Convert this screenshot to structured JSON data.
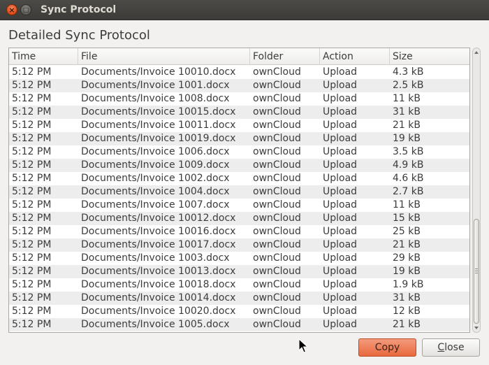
{
  "window": {
    "title": "Sync Protocol"
  },
  "heading": "Detailed Sync Protocol",
  "table": {
    "columns": [
      "Time",
      "File",
      "Folder",
      "Action",
      "Size"
    ],
    "rows": [
      [
        "5:12 PM",
        "Documents/Invoice 10010.docx",
        "ownCloud",
        "Upload",
        "4.3 kB"
      ],
      [
        "5:12 PM",
        "Documents/Invoice 1001.docx",
        "ownCloud",
        "Upload",
        "2.5 kB"
      ],
      [
        "5:12 PM",
        "Documents/Invoice 1008.docx",
        "ownCloud",
        "Upload",
        "11 kB"
      ],
      [
        "5:12 PM",
        "Documents/Invoice 10015.docx",
        "ownCloud",
        "Upload",
        "31 kB"
      ],
      [
        "5:12 PM",
        "Documents/Invoice 10011.docx",
        "ownCloud",
        "Upload",
        "21 kB"
      ],
      [
        "5:12 PM",
        "Documents/Invoice 10019.docx",
        "ownCloud",
        "Upload",
        "19 kB"
      ],
      [
        "5:12 PM",
        "Documents/Invoice 1006.docx",
        "ownCloud",
        "Upload",
        "3.5 kB"
      ],
      [
        "5:12 PM",
        "Documents/Invoice 1009.docx",
        "ownCloud",
        "Upload",
        "4.9 kB"
      ],
      [
        "5:12 PM",
        "Documents/Invoice 1002.docx",
        "ownCloud",
        "Upload",
        "4.6 kB"
      ],
      [
        "5:12 PM",
        "Documents/Invoice 1004.docx",
        "ownCloud",
        "Upload",
        "2.7 kB"
      ],
      [
        "5:12 PM",
        "Documents/Invoice 1007.docx",
        "ownCloud",
        "Upload",
        "11 kB"
      ],
      [
        "5:12 PM",
        "Documents/Invoice 10012.docx",
        "ownCloud",
        "Upload",
        "15 kB"
      ],
      [
        "5:12 PM",
        "Documents/Invoice 10016.docx",
        "ownCloud",
        "Upload",
        "25 kB"
      ],
      [
        "5:12 PM",
        "Documents/Invoice 10017.docx",
        "ownCloud",
        "Upload",
        "21 kB"
      ],
      [
        "5:12 PM",
        "Documents/Invoice 1003.docx",
        "ownCloud",
        "Upload",
        "29 kB"
      ],
      [
        "5:12 PM",
        "Documents/Invoice 10013.docx",
        "ownCloud",
        "Upload",
        "19 kB"
      ],
      [
        "5:12 PM",
        "Documents/Invoice 10018.docx",
        "ownCloud",
        "Upload",
        "1.9 kB"
      ],
      [
        "5:12 PM",
        "Documents/Invoice 10014.docx",
        "ownCloud",
        "Upload",
        "31 kB"
      ],
      [
        "5:12 PM",
        "Documents/Invoice 10020.docx",
        "ownCloud",
        "Upload",
        "12 kB"
      ],
      [
        "5:12 PM",
        "Documents/Invoice 1005.docx",
        "ownCloud",
        "Upload",
        "21 kB"
      ]
    ]
  },
  "buttons": {
    "copy_label": "Copy",
    "close_mnemonic": "C",
    "close_rest": "lose"
  },
  "icons": {
    "close": "close-icon",
    "maximize": "maximize-icon",
    "cursor": "mouse-pointer-icon"
  },
  "colors": {
    "accent": "#e8693d",
    "titlebar": "#3c3b37",
    "window_bg": "#f2f1f0"
  }
}
